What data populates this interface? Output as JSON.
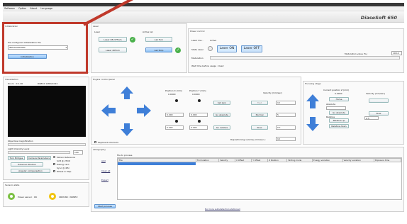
{
  "app": {
    "title": "DiaseSoft 650"
  },
  "menu": [
    "Software",
    "Option",
    "About",
    "Language"
  ],
  "init_panel": {
    "title": "Initialization",
    "config_label": "Pre-configured initialization file",
    "config_value": "INITIALIZATION",
    "init_button": "Initialization"
  },
  "laser_panel": {
    "title": "Laser",
    "laser_label": "Laser",
    "laser_on_btn": "Laser ON 375nm",
    "laser_off_btn": "Laser 405nm",
    "active_label": "Active laz",
    "laz_turn_btn": "Laz Turn",
    "laz_stop_btn": "Laz Stop"
  },
  "power_panel": {
    "title": "Power control",
    "laser_line": "Laser line :",
    "active": "Active",
    "state_label": "State Laser",
    "on_btn": "Laser ON",
    "off_btn": "Laser OFF",
    "modulation": "Modulation",
    "modulation_value_label": "Modulation value (%)",
    "modulation_value": "100.0",
    "wait_label": "Wait time before usage : Used"
  },
  "vis_panel": {
    "title": "Visualization",
    "zoom": "Zoom : X 1.00",
    "resolution": "RGB32 1280x1024",
    "mag_label": "Objective magnification",
    "light_label": "Light Intensity Level",
    "light_value": "100",
    "btn_turn": "Turn Bridges",
    "btn_camera": "Camera Parameters",
    "btn_external": "External Window",
    "btn_angular": "Angular compensation",
    "opt1": "Motion Reference",
    "opt2": "Soft @ 2Hmt",
    "opt3": "Debug card",
    "opt4": "Sync @ 4Hz",
    "opt5": "Wheel in Map"
  },
  "sensors_panel": {
    "title": "Sensors state",
    "sensor1": "Power sensor : OK",
    "sensor2": "XRDUSB : NONEU"
  },
  "engine_panel": {
    "title": "Engine control panel",
    "pos_x_label": "Position X (mm)",
    "pos_x_value": "0.0000",
    "pos_y_label": "Position Y (mm)",
    "pos_y_value": "0.0000",
    "x_set": "0.000",
    "y_set": "0.000",
    "x_step": "0.000",
    "y_step": "0.000",
    "set_zero": "Set zero",
    "go_absolute": "Go absolute",
    "go_relative": "Go relative",
    "velocity_label": "Velocity (mm/sec)",
    "fast": "Fast",
    "fast_value": "10",
    "normal": "Normal",
    "normal_value": "5",
    "slow": "Slow",
    "slow_value": "0.1",
    "repos_label": "Repositioning velocity (mm/sec) :",
    "repos_value": "10",
    "keyboard": "Keyboard shortcuts"
  },
  "focus_panel": {
    "title": "Focusing stage",
    "current_label": "Current position Z (mm)",
    "current_value": "0.0000",
    "velocity_label": "Velocity (mm/sec)",
    "home": "Home",
    "absolute_label": "Absolute",
    "go_absolute": "Go absolute",
    "relative_label": "Relative",
    "relative_up": "Relative up",
    "relative_down": "Relative down",
    "slow": "Slow",
    "slow_value": "0.5"
  },
  "lith_panel": {
    "title": "Lithography",
    "file_label": "File to process",
    "add": "Add",
    "clear_all": "Clear all",
    "export": "Export",
    "columns": [
      "File",
      "Formulation",
      "Velocity",
      "X Offset",
      "Y Offset",
      "Z Position",
      "Writing mode",
      "Energy variation",
      "Velocity variation",
      "Exposure time"
    ],
    "progress_btn": "Start process",
    "footer_link": "No more autodetection stationed"
  }
}
